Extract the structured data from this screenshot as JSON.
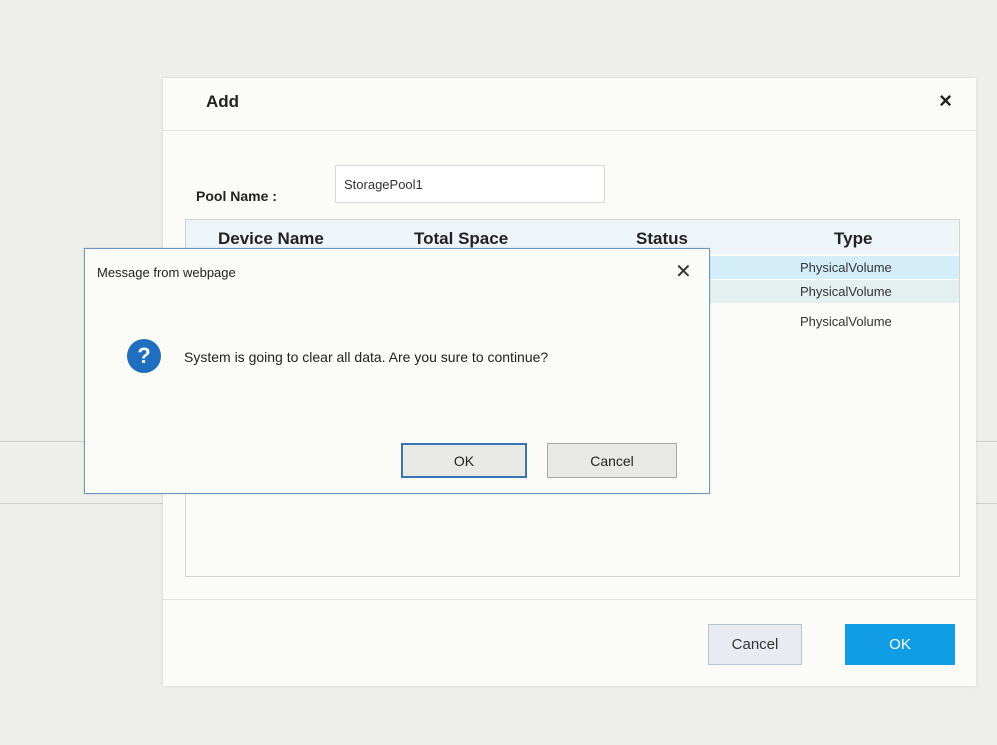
{
  "add_dialog": {
    "title": "Add",
    "close_glyph": "×",
    "pool_label": "Pool Name :",
    "pool_value": "StoragePool1",
    "table": {
      "headers": [
        "Device Name",
        "Total Space",
        "Status",
        "Type"
      ],
      "rows": [
        {
          "type": "PhysicalVolume"
        },
        {
          "type": "PhysicalVolume"
        },
        {
          "type": "PhysicalVolume"
        }
      ]
    },
    "cancel_label": "Cancel",
    "ok_label": "OK"
  },
  "message_box": {
    "title": "Message from webpage",
    "close_glyph": "✕",
    "icon_glyph": "?",
    "message": "System is going to clear all data. Are you sure to continue?",
    "ok_label": "OK",
    "cancel_label": "Cancel"
  },
  "colors": {
    "primary_button": "#119de6",
    "row_selected": "#d4eef9",
    "row_alt": "#e4f0f0",
    "header_row": "#eef5f9",
    "message_border": "#6d97c7",
    "question_icon": "#1e6fc0"
  },
  "icons": [
    "close-icon",
    "question-icon"
  ]
}
